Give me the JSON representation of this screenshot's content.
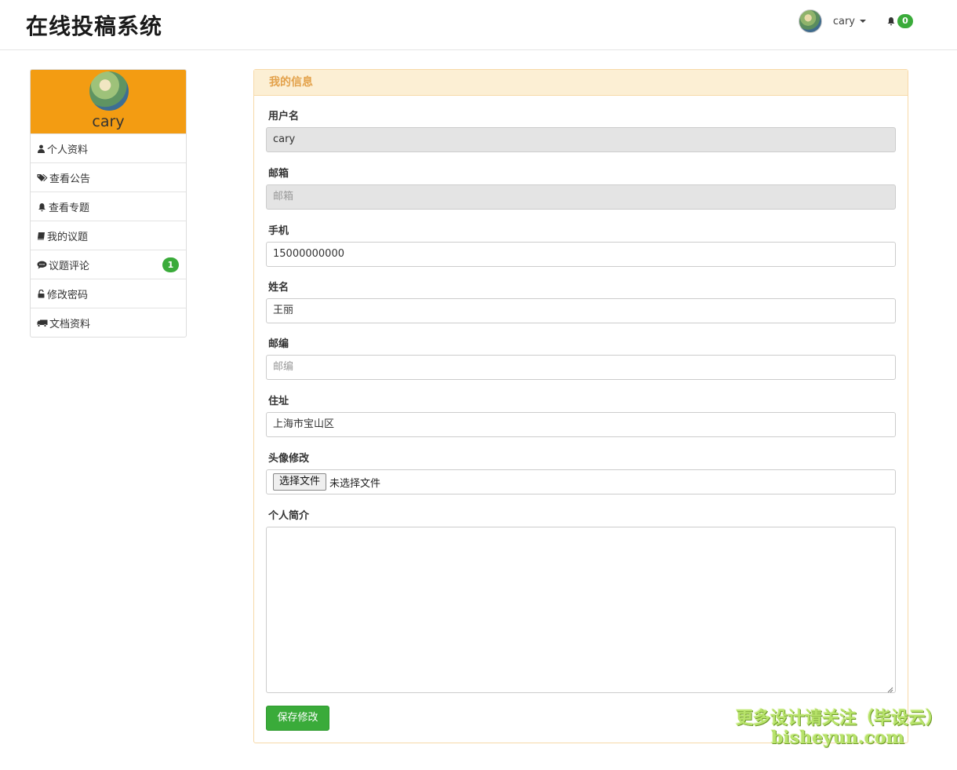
{
  "header": {
    "brand": "在线投稿系统",
    "username": "cary",
    "notification_count": "0"
  },
  "sidebar": {
    "profile_name": "cary",
    "items": [
      {
        "label": "个人资料",
        "icon": "user-icon"
      },
      {
        "label": "查看公告",
        "icon": "tags-icon"
      },
      {
        "label": "查看专题",
        "icon": "bell-icon"
      },
      {
        "label": "我的议题",
        "icon": "book-icon"
      },
      {
        "label": "议题评论",
        "icon": "comment-icon",
        "badge": "1"
      },
      {
        "label": "修改密码",
        "icon": "unlock-icon"
      },
      {
        "label": "文档资料",
        "icon": "truck-icon"
      }
    ]
  },
  "panel": {
    "title": "我的信息",
    "fields": {
      "username": {
        "label": "用户名",
        "value": "cary"
      },
      "email": {
        "label": "邮箱",
        "value": "",
        "placeholder": "邮箱"
      },
      "phone": {
        "label": "手机",
        "value": "15000000000"
      },
      "name": {
        "label": "姓名",
        "value": "王丽"
      },
      "postcode": {
        "label": "邮编",
        "value": "",
        "placeholder": "邮编"
      },
      "address": {
        "label": "住址",
        "value": "上海市宝山区"
      },
      "avatar": {
        "label": "头像修改",
        "button": "选择文件",
        "status": "未选择文件"
      },
      "bio": {
        "label": "个人简介",
        "value": ""
      }
    },
    "save_label": "保存修改"
  },
  "watermark": {
    "line1": "更多设计请关注（毕设云）",
    "line2": "bisheyun.com"
  },
  "colors": {
    "accent_orange": "#f39c12",
    "success_green": "#3aab3a",
    "panel_header_bg": "#fcefd4",
    "panel_title": "#e3a14a"
  }
}
